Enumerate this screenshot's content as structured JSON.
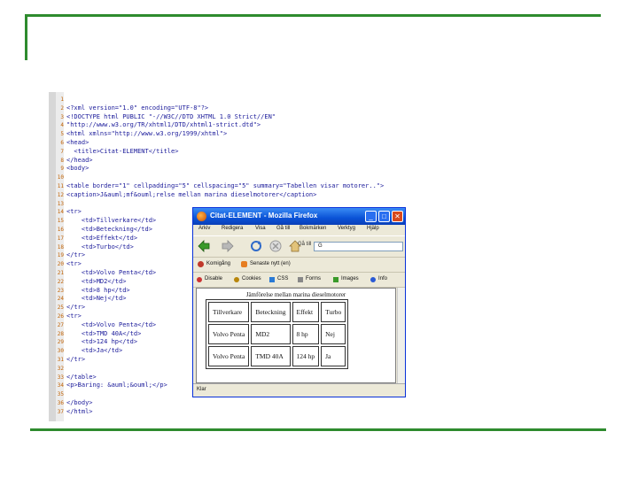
{
  "code_lines": [
    {
      "num": "1",
      "text": ""
    },
    {
      "num": "2",
      "text": "<?xml version=\"1.0\" encoding=\"UTF-8\"?>"
    },
    {
      "num": "3",
      "text": "<!DOCTYPE html PUBLIC \"-//W3C//DTD XHTML 1.0 Strict//EN\""
    },
    {
      "num": "4",
      "text": "\"http://www.w3.org/TR/xhtml1/DTD/xhtml1-strict.dtd\">"
    },
    {
      "num": "5",
      "text": "<html xmlns=\"http://www.w3.org/1999/xhtml\">"
    },
    {
      "num": "6",
      "text": "<head>"
    },
    {
      "num": "7",
      "text": "  <title>Citat-ELEMENT</title>"
    },
    {
      "num": "8",
      "text": "</head>"
    },
    {
      "num": "9",
      "text": "<body>"
    },
    {
      "num": "10",
      "text": ""
    },
    {
      "num": "11",
      "text": "<table border=\"1\" cellpadding=\"5\" cellspacing=\"5\" summary=\"Tabellen visar motorer..\">"
    },
    {
      "num": "12",
      "text": "<caption>J&auml;mf&ouml;relse mellan marina dieselmotorer</caption>"
    },
    {
      "num": "13",
      "text": ""
    },
    {
      "num": "14",
      "text": "<tr>"
    },
    {
      "num": "15",
      "text": "    <td>Tillverkare</td>"
    },
    {
      "num": "16",
      "text": "    <td>Beteckning</td>"
    },
    {
      "num": "17",
      "text": "    <td>Effekt</td>"
    },
    {
      "num": "18",
      "text": "    <td>Turbo</td>"
    },
    {
      "num": "19",
      "text": "</tr>"
    },
    {
      "num": "20",
      "text": "<tr>"
    },
    {
      "num": "21",
      "text": "    <td>Volvo Penta</td>"
    },
    {
      "num": "22",
      "text": "    <td>MD2</td>"
    },
    {
      "num": "23",
      "text": "    <td>8 hp</td>"
    },
    {
      "num": "24",
      "text": "    <td>Nej</td>"
    },
    {
      "num": "25",
      "text": "</tr>"
    },
    {
      "num": "26",
      "text": "<tr>"
    },
    {
      "num": "27",
      "text": "    <td>Volvo Penta</td>"
    },
    {
      "num": "28",
      "text": "    <td>TMD 40A</td>"
    },
    {
      "num": "29",
      "text": "    <td>124 hp</td>"
    },
    {
      "num": "30",
      "text": "    <td>Ja</td>"
    },
    {
      "num": "31",
      "text": "</tr>"
    },
    {
      "num": "32",
      "text": ""
    },
    {
      "num": "33",
      "text": "</table>"
    },
    {
      "num": "34",
      "text": "<p>Baring: &auml;&ouml;</p>"
    },
    {
      "num": "35",
      "text": ""
    },
    {
      "num": "36",
      "text": "</body>"
    },
    {
      "num": "37",
      "text": "</html>"
    }
  ],
  "browser": {
    "title": "Citat-ELEMENT - Mozilla Firefox",
    "menu": [
      "Arkiv",
      "Redigera",
      "Visa",
      "Gå till",
      "Bokmärken",
      "Verktyg",
      "Hjälp"
    ],
    "url_go": "Gå till",
    "url_text": "G",
    "bookmarks": [
      "Komigång",
      "Senaste nytt (en)"
    ],
    "webdev": [
      "Disable",
      "Cookies",
      "CSS",
      "Forms",
      "Images",
      "Info"
    ],
    "caption": "Jämförelse mellan marina dieselmotorer",
    "table": [
      [
        "Tillverkare",
        "Beteckning",
        "Effekt",
        "Turbo"
      ],
      [
        "Volvo Penta",
        "MD2",
        "8 hp",
        "Nej"
      ],
      [
        "Volvo Penta",
        "TMD 40A",
        "124 hp",
        "Ja"
      ]
    ],
    "status": "Klar"
  }
}
